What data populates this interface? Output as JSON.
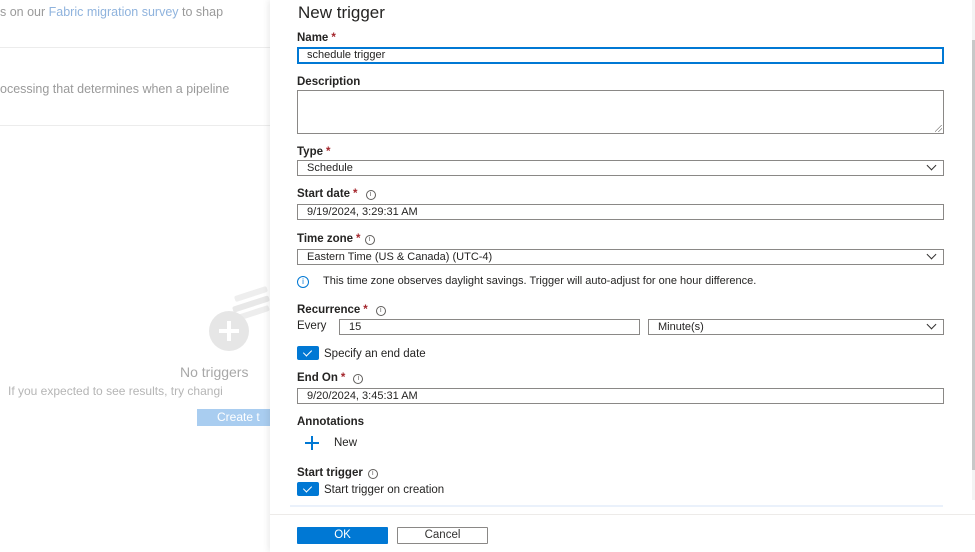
{
  "background": {
    "banner_prefix": "s on our ",
    "banner_link": "Fabric migration survey",
    "banner_suffix": " to shap",
    "description": "ocessing that determines when a pipeline",
    "empty_title": "No triggers",
    "empty_subtitle": "If you expected to see results, try changi",
    "create_button": "Create t"
  },
  "panel": {
    "title": "New trigger",
    "name": {
      "label": "Name",
      "value": "schedule trigger"
    },
    "description": {
      "label": "Description",
      "value": ""
    },
    "type": {
      "label": "Type",
      "value": "Schedule"
    },
    "start_date": {
      "label": "Start date",
      "value": "9/19/2024, 3:29:31 AM"
    },
    "time_zone": {
      "label": "Time zone",
      "value": "Eastern Time (US & Canada) (UTC-4)",
      "note": "This time zone observes daylight savings. Trigger will auto-adjust for one hour difference."
    },
    "recurrence": {
      "label": "Recurrence",
      "every_label": "Every",
      "interval": "15",
      "unit": "Minute(s)"
    },
    "end_date": {
      "checkbox_label": "Specify an end date",
      "checked": true,
      "label": "End On",
      "value": "9/20/2024, 3:45:31 AM"
    },
    "annotations": {
      "label": "Annotations",
      "new_label": "New"
    },
    "start_trigger": {
      "label": "Start trigger",
      "checkbox_label": "Start trigger on creation",
      "checked": true
    },
    "buttons": {
      "ok": "OK",
      "cancel": "Cancel"
    }
  },
  "colors": {
    "accent": "#0078d4",
    "required": "#a4262c"
  },
  "icons": [
    "info-icon",
    "chevron-down-icon",
    "checkmark-icon",
    "plus-icon"
  ]
}
